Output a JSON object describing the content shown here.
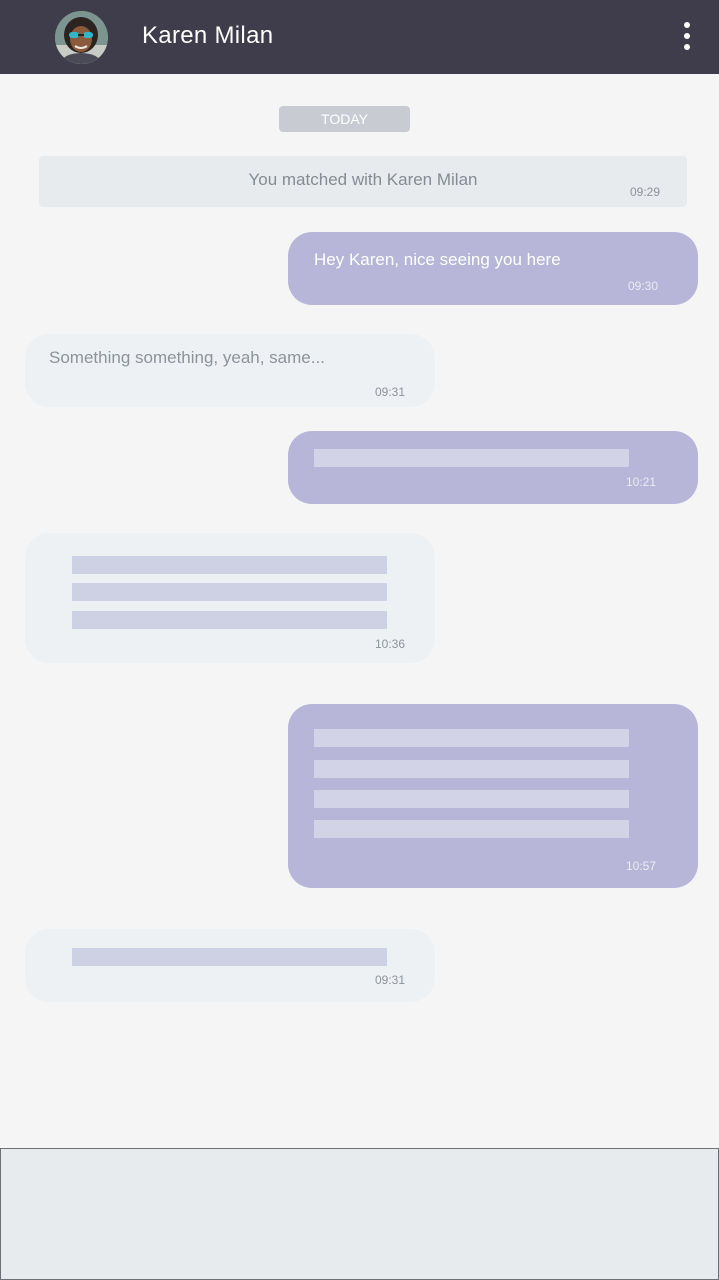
{
  "header": {
    "contact_name": "Karen Milan",
    "avatar_icon": "user-avatar",
    "menu_icon": "more-vertical-icon",
    "background_color": "#3f3c4b"
  },
  "chat": {
    "date_label": "TODAY",
    "system_message": {
      "text": "You matched with Karen Milan",
      "time": "09:29"
    },
    "messages": [
      {
        "direction": "outgoing",
        "text": "Hey Karen, nice seeing you here",
        "time": "09:30"
      },
      {
        "direction": "incoming",
        "text": "Something something, yeah, same...",
        "time": "09:31"
      },
      {
        "direction": "outgoing",
        "placeholder_lines": 1,
        "time": "10:21"
      },
      {
        "direction": "incoming",
        "placeholder_lines": 3,
        "time": "10:36"
      },
      {
        "direction": "outgoing",
        "placeholder_lines": 4,
        "time": "10:57"
      },
      {
        "direction": "incoming",
        "placeholder_lines": 1,
        "time": "09:31"
      }
    ]
  },
  "colors": {
    "outgoing_bubble": "#b7b6d8",
    "incoming_bubble": "#eef1f4",
    "background": "#f5f5f6"
  },
  "composer": {
    "placeholder": ""
  }
}
